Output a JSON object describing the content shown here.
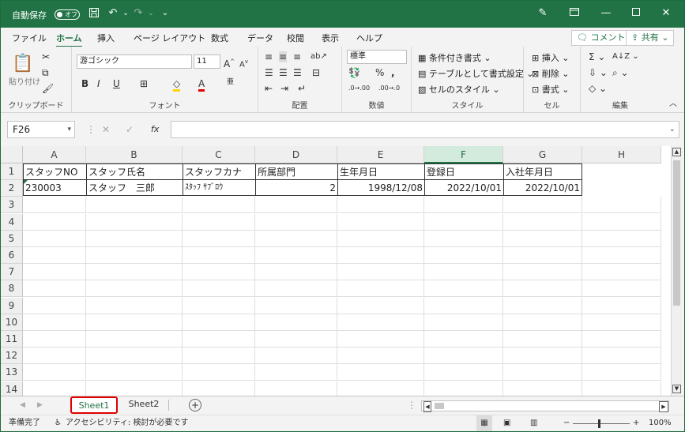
{
  "title_bar": {
    "autosave": "自動保存",
    "autosave_state": "オフ",
    "dropdown": "⌄"
  },
  "tabs": [
    "ファイル",
    "ホーム",
    "挿入",
    "ページ レイアウト",
    "数式",
    "データ",
    "校閲",
    "表示",
    "ヘルプ"
  ],
  "active_tab": "ホーム",
  "comment_button": "コメント",
  "share_button": "共有",
  "ribbon": {
    "clipboard": {
      "paste": "貼り付け",
      "label": "クリップボード"
    },
    "font": {
      "name": "游ゴシック",
      "size": "11",
      "label": "フォント",
      "bold": "B",
      "italic": "I",
      "underline": "U"
    },
    "alignment": {
      "label": "配置"
    },
    "number": {
      "format": "標準",
      "label": "数値"
    },
    "styles": {
      "conditional": "条件付き書式",
      "table": "テーブルとして書式設定",
      "cell_styles": "セルのスタイル",
      "label": "スタイル"
    },
    "cells": {
      "insert": "挿入",
      "delete": "削除",
      "format": "書式",
      "label": "セル"
    },
    "editing": {
      "label": "編集"
    }
  },
  "name_box": "F26",
  "formula": "",
  "columns": [
    "A",
    "B",
    "C",
    "D",
    "E",
    "F",
    "G",
    "H"
  ],
  "selected_column": "F",
  "rows": [
    "1",
    "2",
    "3",
    "4",
    "5",
    "6",
    "7",
    "8",
    "9",
    "10",
    "11",
    "12",
    "13",
    "14"
  ],
  "cells": {
    "row1": [
      "スタッフNO",
      "スタッフ氏名",
      "スタッフカナ",
      "所属部門",
      "生年月日",
      "登録日",
      "入社年月日"
    ],
    "row2": [
      "230003",
      "スタッフ　三郎",
      "ｽﾀｯﾌ ｻﾌﾞﾛｳ",
      "2",
      "1998/12/08",
      "2022/10/01",
      "2022/10/01"
    ]
  },
  "sheets": [
    "Sheet1",
    "Sheet2"
  ],
  "active_sheet": "Sheet1",
  "status": {
    "ready": "準備完了",
    "accessibility": "アクセシビリティ: 検討が必要です",
    "zoom": "100%"
  }
}
